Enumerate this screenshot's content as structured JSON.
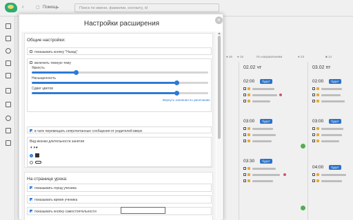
{
  "header": {
    "back_icon": "chevron-left-icon",
    "help_label": "Помощь",
    "search_placeholder": "Поиск по имени, фамилии, контакту, id"
  },
  "sidebar": {
    "icons": [
      "calendar-icon",
      "list-icon",
      "search-icon",
      "clipboard-icon",
      "book-icon",
      "chart-icon",
      "grid-icon",
      "users-icon",
      "file-icon",
      "table-icon"
    ]
  },
  "background": {
    "filter_label": "По направлениям",
    "days": [
      "02.02 чт",
      "03.02 пт"
    ],
    "badge": "будет",
    "times": [
      "02:00",
      "03:00",
      "03:30",
      "02:00",
      "03:00",
      "04:00"
    ]
  },
  "modal": {
    "title": "Настройки расширения",
    "close_icon": "close-icon",
    "general": {
      "title": "Общие настройки:",
      "show_back_button": "показывать кнопку \"Назад\"",
      "dark_theme": "включить темную тему",
      "brightness_label": "Яркость",
      "brightness": 0.25,
      "saturation_label": "Насыщенность",
      "saturation": 0.82,
      "hue_label": "Сдвиг цветов",
      "hue": 0.82,
      "reset_link": "Вернуть значения по умолчанию",
      "chat_option": "в чате перемещать непрочитанные сообщения от родителей вверх",
      "duration_label": "Вид иконки длительности занятия"
    },
    "lesson": {
      "title": "На странице урока:",
      "show_city": "показывать город ученика",
      "show_time": "показывать время ученика",
      "show_self_btn": "показывать кнопку самостоятельности"
    }
  },
  "colors": {
    "accent": "#2d7ad6",
    "logo": "#2db87a",
    "badge": "#2d7ad6"
  }
}
